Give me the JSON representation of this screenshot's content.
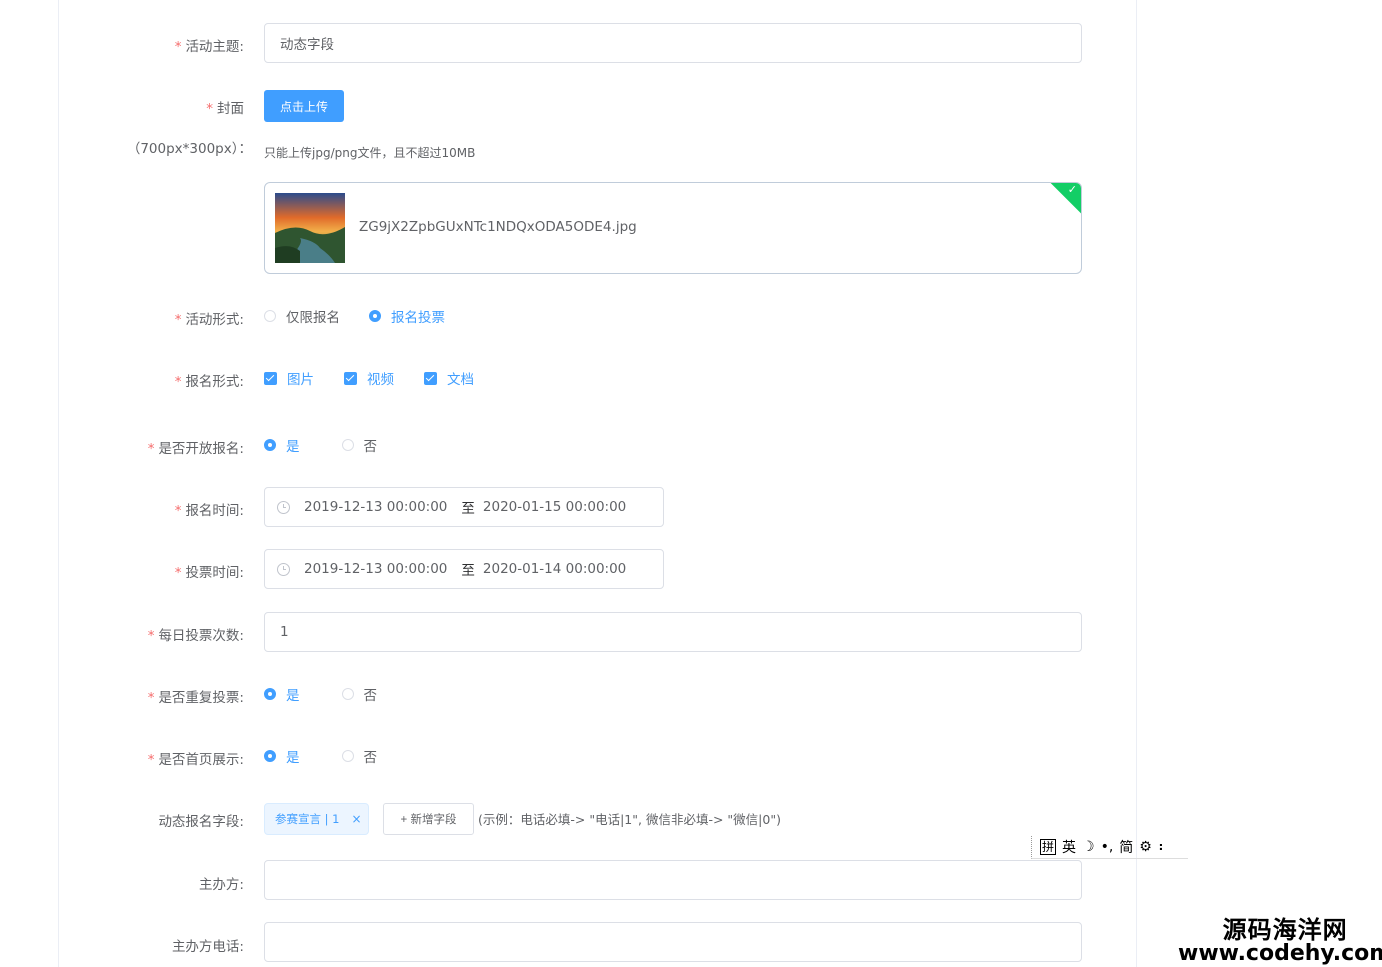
{
  "form": {
    "title_label": "活动主题:",
    "title_value": "动态字段",
    "cover_label": "封面",
    "cover_size": "（700px*300px）：",
    "upload_button": "点击上传",
    "upload_tip": "只能上传jpg/png文件，且不超过10MB",
    "uploaded_file": "ZG9jX2ZpbGUxNTc1NDQxODA5ODE4.jpg",
    "activity_form_label": "活动形式:",
    "activity_form_options": [
      "仅限报名",
      "报名投票"
    ],
    "activity_form_selected": "报名投票",
    "signup_form_label": "报名形式:",
    "signup_form_options": [
      "图片",
      "视频",
      "文档"
    ],
    "open_signup_label": "是否开放报名:",
    "open_signup_options": [
      "是",
      "否"
    ],
    "signup_time_label": "报名时间:",
    "signup_time_start": "2019-12-13 00:00:00",
    "signup_time_end": "2020-01-15 00:00:00",
    "range_sep": "至",
    "vote_time_label": "投票时间:",
    "vote_time_start": "2019-12-13 00:00:00",
    "vote_time_end": "2020-01-14 00:00:00",
    "daily_votes_label": "每日投票次数:",
    "daily_votes_value": "1",
    "repeat_vote_label": "是否重复投票:",
    "repeat_vote_options": [
      "是",
      "否"
    ],
    "homepage_label": "是否首页展示:",
    "homepage_options": [
      "是",
      "否"
    ],
    "dynamic_fields_label": "动态报名字段:",
    "dynamic_field_tag": "参赛宣言 | 1",
    "tag_close": "×",
    "add_field_button": "+ 新增字段",
    "dynamic_example": "(示例：电话必填-> \"电话|1\", 微信非必填-> \"微信|0\")",
    "organizer_label": "主办方:",
    "organizer_value": "",
    "organizer_phone_label": "主办方电话:",
    "organizer_phone_value": ""
  },
  "required_mark": "*",
  "ime_bar": {
    "mode_box": "拼",
    "items": [
      "英",
      "☽",
      "•,",
      "简",
      "⚙",
      "⠆"
    ]
  },
  "watermark": {
    "line1": "源码海洋网",
    "line2": "www.codehy.com"
  },
  "colors": {
    "primary": "#409eff",
    "success": "#13ce66",
    "required": "#f56c6c",
    "border": "#dcdfe6"
  }
}
